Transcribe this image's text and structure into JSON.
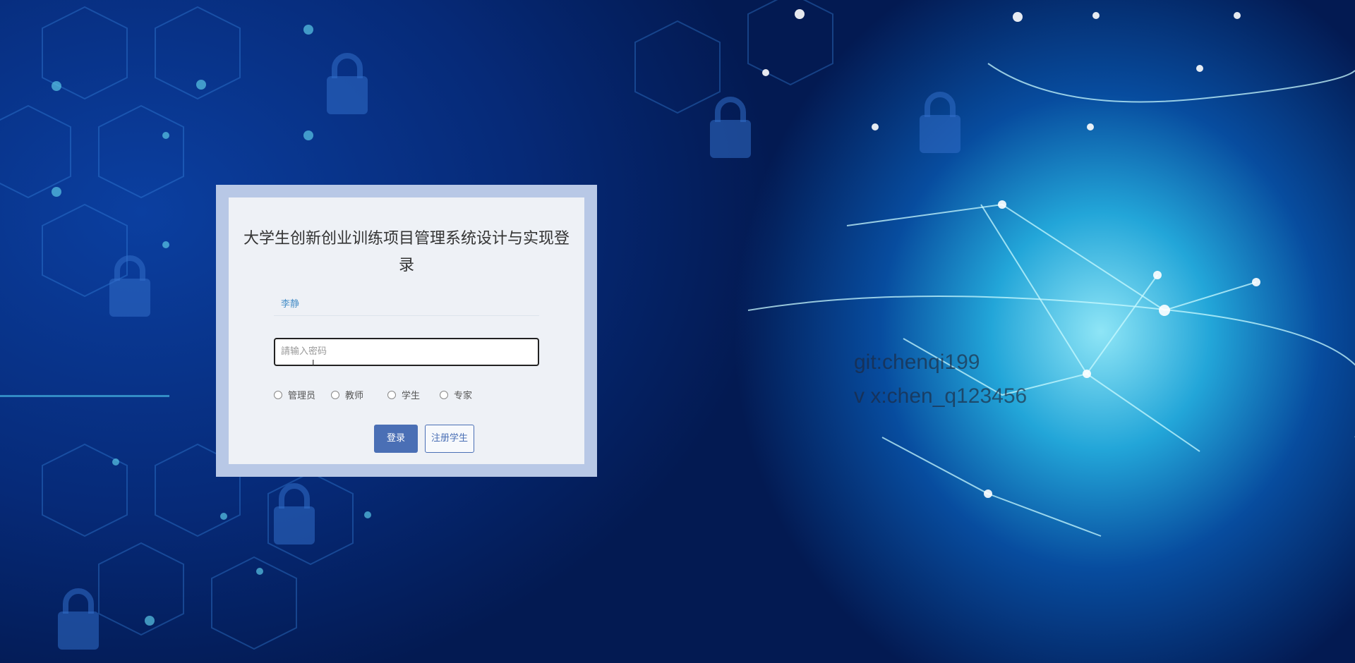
{
  "login": {
    "title": "大学生创新创业训练项目管理系统设计与实现登录",
    "username_value": "李静",
    "password_placeholder": "請输入密码",
    "roles": [
      "管理员",
      "教师",
      "学生",
      "专家"
    ],
    "login_label": "登录",
    "register_label": "注册学生"
  },
  "watermark": {
    "line1": "git:chenqi199",
    "line2": "v x:chen_q123456"
  },
  "colors": {
    "accent": "#4a6fb5",
    "panel_frame": "#b8c8e6",
    "panel_bg": "#eef1f6"
  }
}
